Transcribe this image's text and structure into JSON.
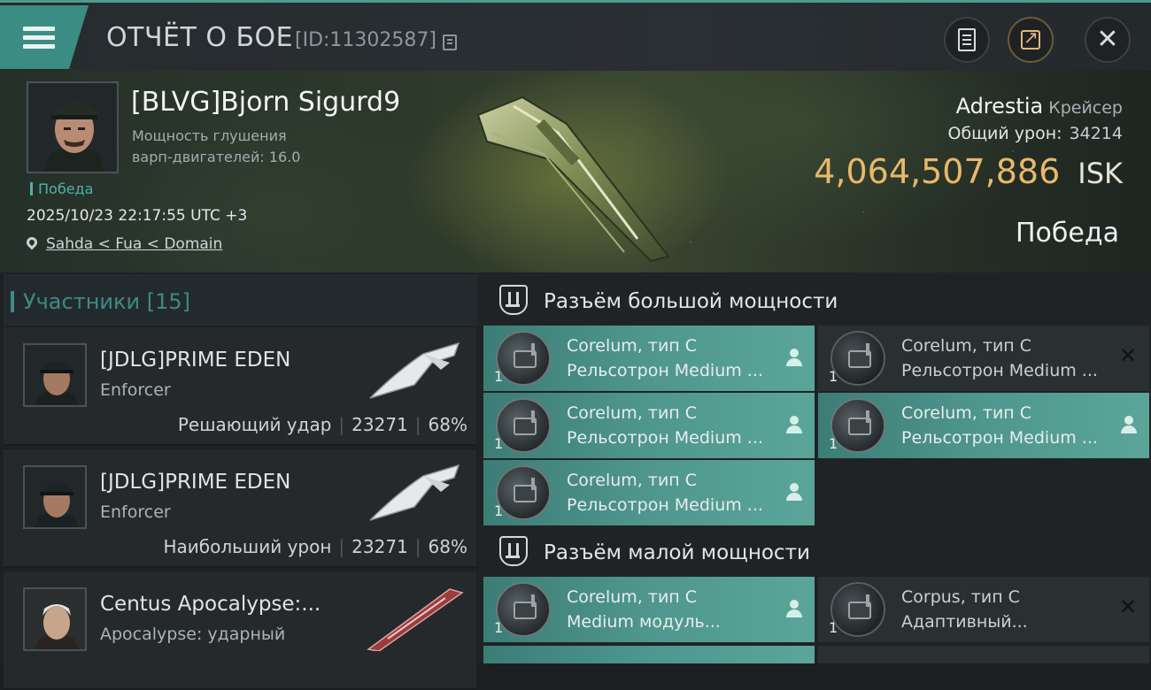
{
  "header": {
    "title": "ОТЧЁТ О БОЕ",
    "report_id": "[ID:11302587]",
    "icons": [
      "menu-icon",
      "copy-icon",
      "clipboard-icon",
      "share-icon",
      "close-icon"
    ]
  },
  "victim": {
    "pilot_name": "[BLVG]Bjorn Sigurd9",
    "warp_jam_line1": "Мощность глушения",
    "warp_jam_line2": "варп-двигателей: 16.0",
    "result_tag": "Победа",
    "datetime": "2025/10/23 22:17:55 UTC +3",
    "location": "Sahda < Fua < Domain",
    "ship_name": "Adrestia",
    "ship_class": "Крейсер",
    "total_damage_label": "Общий урон:",
    "total_damage_value": "34214",
    "isk_value": "4,064,507,886",
    "isk_unit": "ISK",
    "outcome": "Победа"
  },
  "participants": {
    "label": "Участники [15]",
    "rows": [
      {
        "name": "[JDLG]PRIME EDEN",
        "ship": "Enforcer",
        "role": "Решающий удар",
        "damage": "23271",
        "percent": "68%"
      },
      {
        "name": "[JDLG]PRIME EDEN",
        "ship": "Enforcer",
        "role": "Наибольший урон",
        "damage": "23271",
        "percent": "68%"
      },
      {
        "name": "Centus Apocalypse:...",
        "ship": "Apocalypse: ударный"
      }
    ]
  },
  "high_slots": {
    "title": "Разъём большой мощности",
    "items": [
      {
        "name": "Corelum, тип C",
        "type": "Рельсотрон Medium ...",
        "qty": "1",
        "state": "active"
      },
      {
        "name": "Corelum, тип C",
        "type": "Рельсотрон Medium ...",
        "qty": "1",
        "state": "destroyed"
      },
      {
        "name": "Corelum, тип C",
        "type": "Рельсотрон Medium ...",
        "qty": "1",
        "state": "active"
      },
      {
        "name": "Corelum, тип C",
        "type": "Рельсотрон Medium ...",
        "qty": "1",
        "state": "active"
      },
      {
        "name": "Corelum, тип C",
        "type": "Рельсотрон Medium ...",
        "qty": "1",
        "state": "active"
      }
    ]
  },
  "low_slots": {
    "title": "Разъём малой мощности",
    "items": [
      {
        "name": "Corelum, тип C",
        "type": "Medium модуль...",
        "qty": "1",
        "state": "active"
      },
      {
        "name": "Corpus, тип C",
        "type": "Адаптивный...",
        "qty": "1",
        "state": "destroyed"
      }
    ]
  },
  "colors": {
    "accent": "#3b8c83",
    "isk": "#e8b86a",
    "slot_active": "#4f978e"
  }
}
